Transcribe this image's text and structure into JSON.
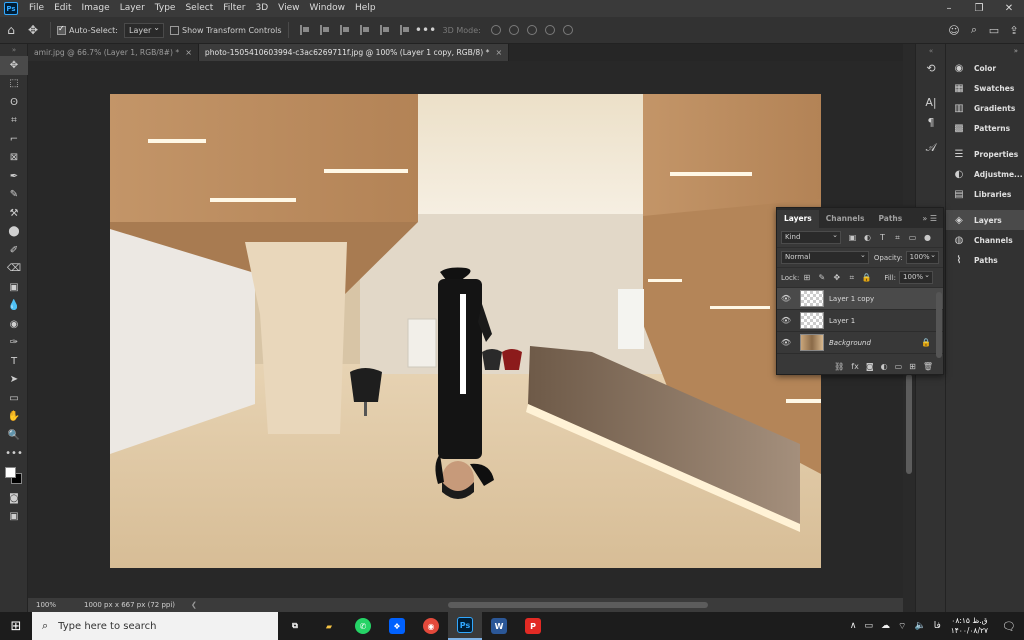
{
  "app": {
    "logo": "Ps"
  },
  "menu": [
    "File",
    "Edit",
    "Image",
    "Layer",
    "Type",
    "Select",
    "Filter",
    "3D",
    "View",
    "Window",
    "Help"
  ],
  "window_controls": [
    "–",
    "❐",
    "✕"
  ],
  "options": {
    "auto_select_label": "Auto-Select:",
    "auto_select_value": "Layer",
    "show_transform_label": "Show Transform Controls",
    "mode_3d_label": "3D Mode:"
  },
  "tabs": [
    {
      "label": "amir.jpg @ 66.7% (Layer 1, RGB/8#) *",
      "close": "×"
    },
    {
      "label": "photo-1505410603994-c3ac6269711f.jpg @ 100% (Layer 1 copy, RGB/8) *",
      "close": "×"
    }
  ],
  "status": {
    "zoom": "100%",
    "doc_info": "1000 px x 667 px (72 ppi)",
    "arrow": "❮"
  },
  "tools": [
    "✥",
    "⬚",
    "ʘ",
    "⌗",
    "⌐",
    "⊠",
    "✒",
    "✎",
    "⚒",
    "⬤",
    "✐",
    "⌫",
    "▣",
    "💧",
    "◉",
    "✑",
    "T",
    "➤",
    "▭",
    "✋",
    "🔍",
    "•••"
  ],
  "dock": {
    "group1": [
      {
        "label": "Color",
        "icon": "color-icon",
        "glyph": "◉"
      },
      {
        "label": "Swatches",
        "icon": "swatches-icon",
        "glyph": "▦"
      },
      {
        "label": "Gradients",
        "icon": "gradients-icon",
        "glyph": "▥"
      },
      {
        "label": "Patterns",
        "icon": "patterns-icon",
        "glyph": "▩"
      }
    ],
    "group2": [
      {
        "label": "Properties",
        "icon": "properties-icon",
        "glyph": "☰"
      },
      {
        "label": "Adjustme...",
        "icon": "adjustments-icon",
        "glyph": "◐"
      },
      {
        "label": "Libraries",
        "icon": "libraries-icon",
        "glyph": "▤"
      }
    ],
    "group3": [
      {
        "label": "Layers",
        "icon": "layers-icon",
        "glyph": "◈"
      },
      {
        "label": "Channels",
        "icon": "channels-icon",
        "glyph": "◍"
      },
      {
        "label": "Paths",
        "icon": "paths-icon",
        "glyph": "⌇"
      }
    ]
  },
  "layers_panel": {
    "tabs": [
      "Layers",
      "Channels",
      "Paths"
    ],
    "filter_kind": "Kind",
    "blend_mode": "Normal",
    "opacity_label": "Opacity:",
    "opacity_value": "100%",
    "lock_label": "Lock:",
    "fill_label": "Fill:",
    "fill_value": "100%",
    "layers": [
      {
        "name": "Layer 1 copy",
        "selected": true,
        "type": "pixel"
      },
      {
        "name": "Layer 1",
        "selected": false,
        "type": "pixel"
      },
      {
        "name": "Background",
        "selected": false,
        "type": "background",
        "locked": true
      }
    ]
  },
  "taskbar": {
    "search_placeholder": "Type here to search",
    "apps": [
      {
        "name": "task-view",
        "glyph": "⧉",
        "color": "#ffffff",
        "bg": "transparent"
      },
      {
        "name": "file-explorer",
        "glyph": "▰",
        "color": "#f6c343",
        "bg": "transparent"
      },
      {
        "name": "whatsapp",
        "glyph": "✆",
        "color": "#ffffff",
        "bg": "#25d366"
      },
      {
        "name": "dropbox",
        "glyph": "❖",
        "color": "#ffffff",
        "bg": "#0061fe"
      },
      {
        "name": "chrome",
        "glyph": "◉",
        "color": "#ffffff",
        "bg": "#e3493b"
      },
      {
        "name": "photoshop",
        "glyph": "Ps",
        "color": "#31a8ff",
        "bg": "#001e36",
        "active": true
      },
      {
        "name": "word",
        "glyph": "W",
        "color": "#ffffff",
        "bg": "#2b5797"
      },
      {
        "name": "acrobat",
        "glyph": "P",
        "color": "#ffffff",
        "bg": "#e22a24"
      }
    ],
    "lang": "فا",
    "time": "۰۸:۱۵ ق.ظ",
    "date": "۱۴۰۰/۰۸/۲۷",
    "tray_icons": [
      "∧",
      "▭",
      "☁",
      "⌔",
      "🔈"
    ]
  }
}
